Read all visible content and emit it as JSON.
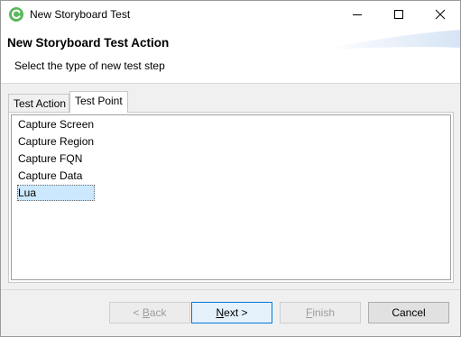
{
  "window": {
    "title": "New Storyboard Test",
    "controls": {
      "minimize_icon": "minimize-icon",
      "maximize_icon": "maximize-icon",
      "close_icon": "close-icon"
    }
  },
  "header": {
    "title": "New Storyboard Test Action",
    "subtitle": "Select the type of new test step"
  },
  "tabs": [
    {
      "label": "Test Action",
      "active": false
    },
    {
      "label": "Test Point",
      "active": true
    }
  ],
  "list": {
    "items": [
      {
        "label": "Capture Screen",
        "selected": false
      },
      {
        "label": "Capture Region",
        "selected": false
      },
      {
        "label": "Capture FQN",
        "selected": false
      },
      {
        "label": "Capture Data",
        "selected": false
      },
      {
        "label": "Lua",
        "selected": true
      }
    ]
  },
  "buttons": {
    "back": {
      "prefix": "< ",
      "mnemonic": "B",
      "rest": "ack",
      "enabled": false
    },
    "next": {
      "mnemonic": "N",
      "rest": "ext >",
      "enabled": true
    },
    "finish": {
      "mnemonic": "F",
      "rest": "inish",
      "enabled": false
    },
    "cancel": {
      "label": "Cancel",
      "enabled": true
    }
  },
  "colors": {
    "accent": "#0078d7",
    "selection": "#cce8ff",
    "app_icon": "#5cb85c"
  }
}
